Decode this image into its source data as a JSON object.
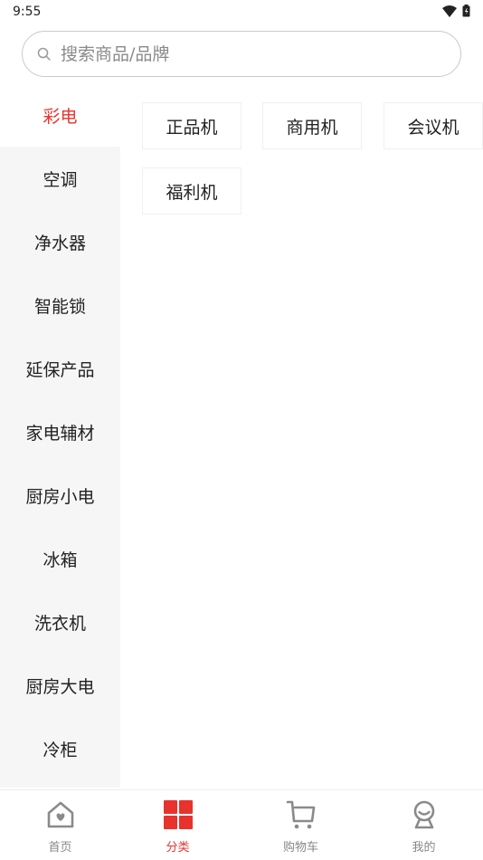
{
  "status_bar": {
    "time": "9:55"
  },
  "search": {
    "placeholder": "搜索商品/品牌"
  },
  "sidebar": {
    "items": [
      {
        "label": "彩电",
        "active": true
      },
      {
        "label": "空调"
      },
      {
        "label": "净水器"
      },
      {
        "label": "智能锁"
      },
      {
        "label": "延保产品"
      },
      {
        "label": "家电辅材"
      },
      {
        "label": "厨房小电"
      },
      {
        "label": "冰箱"
      },
      {
        "label": "洗衣机"
      },
      {
        "label": "厨房大电"
      },
      {
        "label": "冷柜"
      }
    ]
  },
  "subcategories": [
    {
      "label": "正品机"
    },
    {
      "label": "商用机"
    },
    {
      "label": "会议机"
    },
    {
      "label": "福利机"
    }
  ],
  "bottom_nav": {
    "items": [
      {
        "label": "首页",
        "icon": "home-icon"
      },
      {
        "label": "分类",
        "icon": "category-grid-icon",
        "active": true
      },
      {
        "label": "购物车",
        "icon": "cart-icon"
      },
      {
        "label": "我的",
        "icon": "profile-icon"
      }
    ]
  },
  "colors": {
    "accent": "#e8322d",
    "sidebar_bg": "#f6f6f6",
    "inactive_nav": "#888888"
  }
}
